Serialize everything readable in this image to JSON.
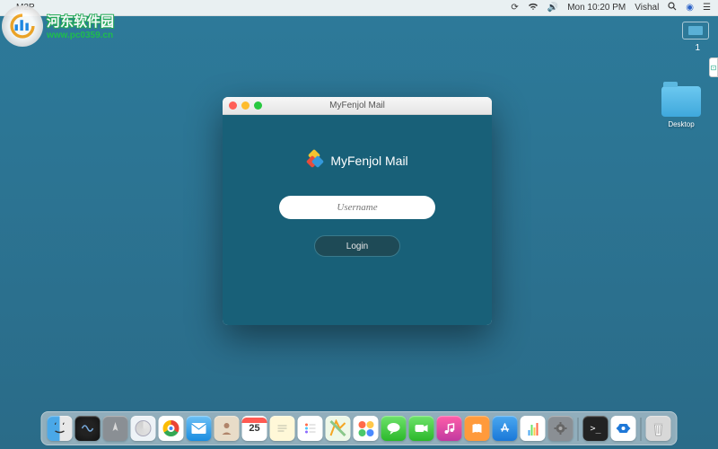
{
  "menubar": {
    "app_name": "M2P",
    "time": "Mon 10:20 PM",
    "user": "Vishal"
  },
  "watermark": {
    "site_name_cn": "河东软件园",
    "site_url": "www.pc0359.cn"
  },
  "workspace": {
    "number": "1"
  },
  "desktop": {
    "folder_label": "Desktop"
  },
  "window": {
    "title": "MyFenjol Mail",
    "brand": "MyFenjol Mail",
    "username_placeholder": "Username",
    "login_label": "Login"
  },
  "dock": {
    "calendar_day": "25",
    "items": [
      "finder",
      "siri",
      "launchpad",
      "safari",
      "chrome",
      "mail",
      "contacts",
      "calendar",
      "notes",
      "reminders",
      "maps",
      "photos",
      "messages",
      "facetime",
      "itunes",
      "ibooks",
      "appstore",
      "numbers",
      "preferences",
      "terminal",
      "teamviewer",
      "trash"
    ]
  }
}
